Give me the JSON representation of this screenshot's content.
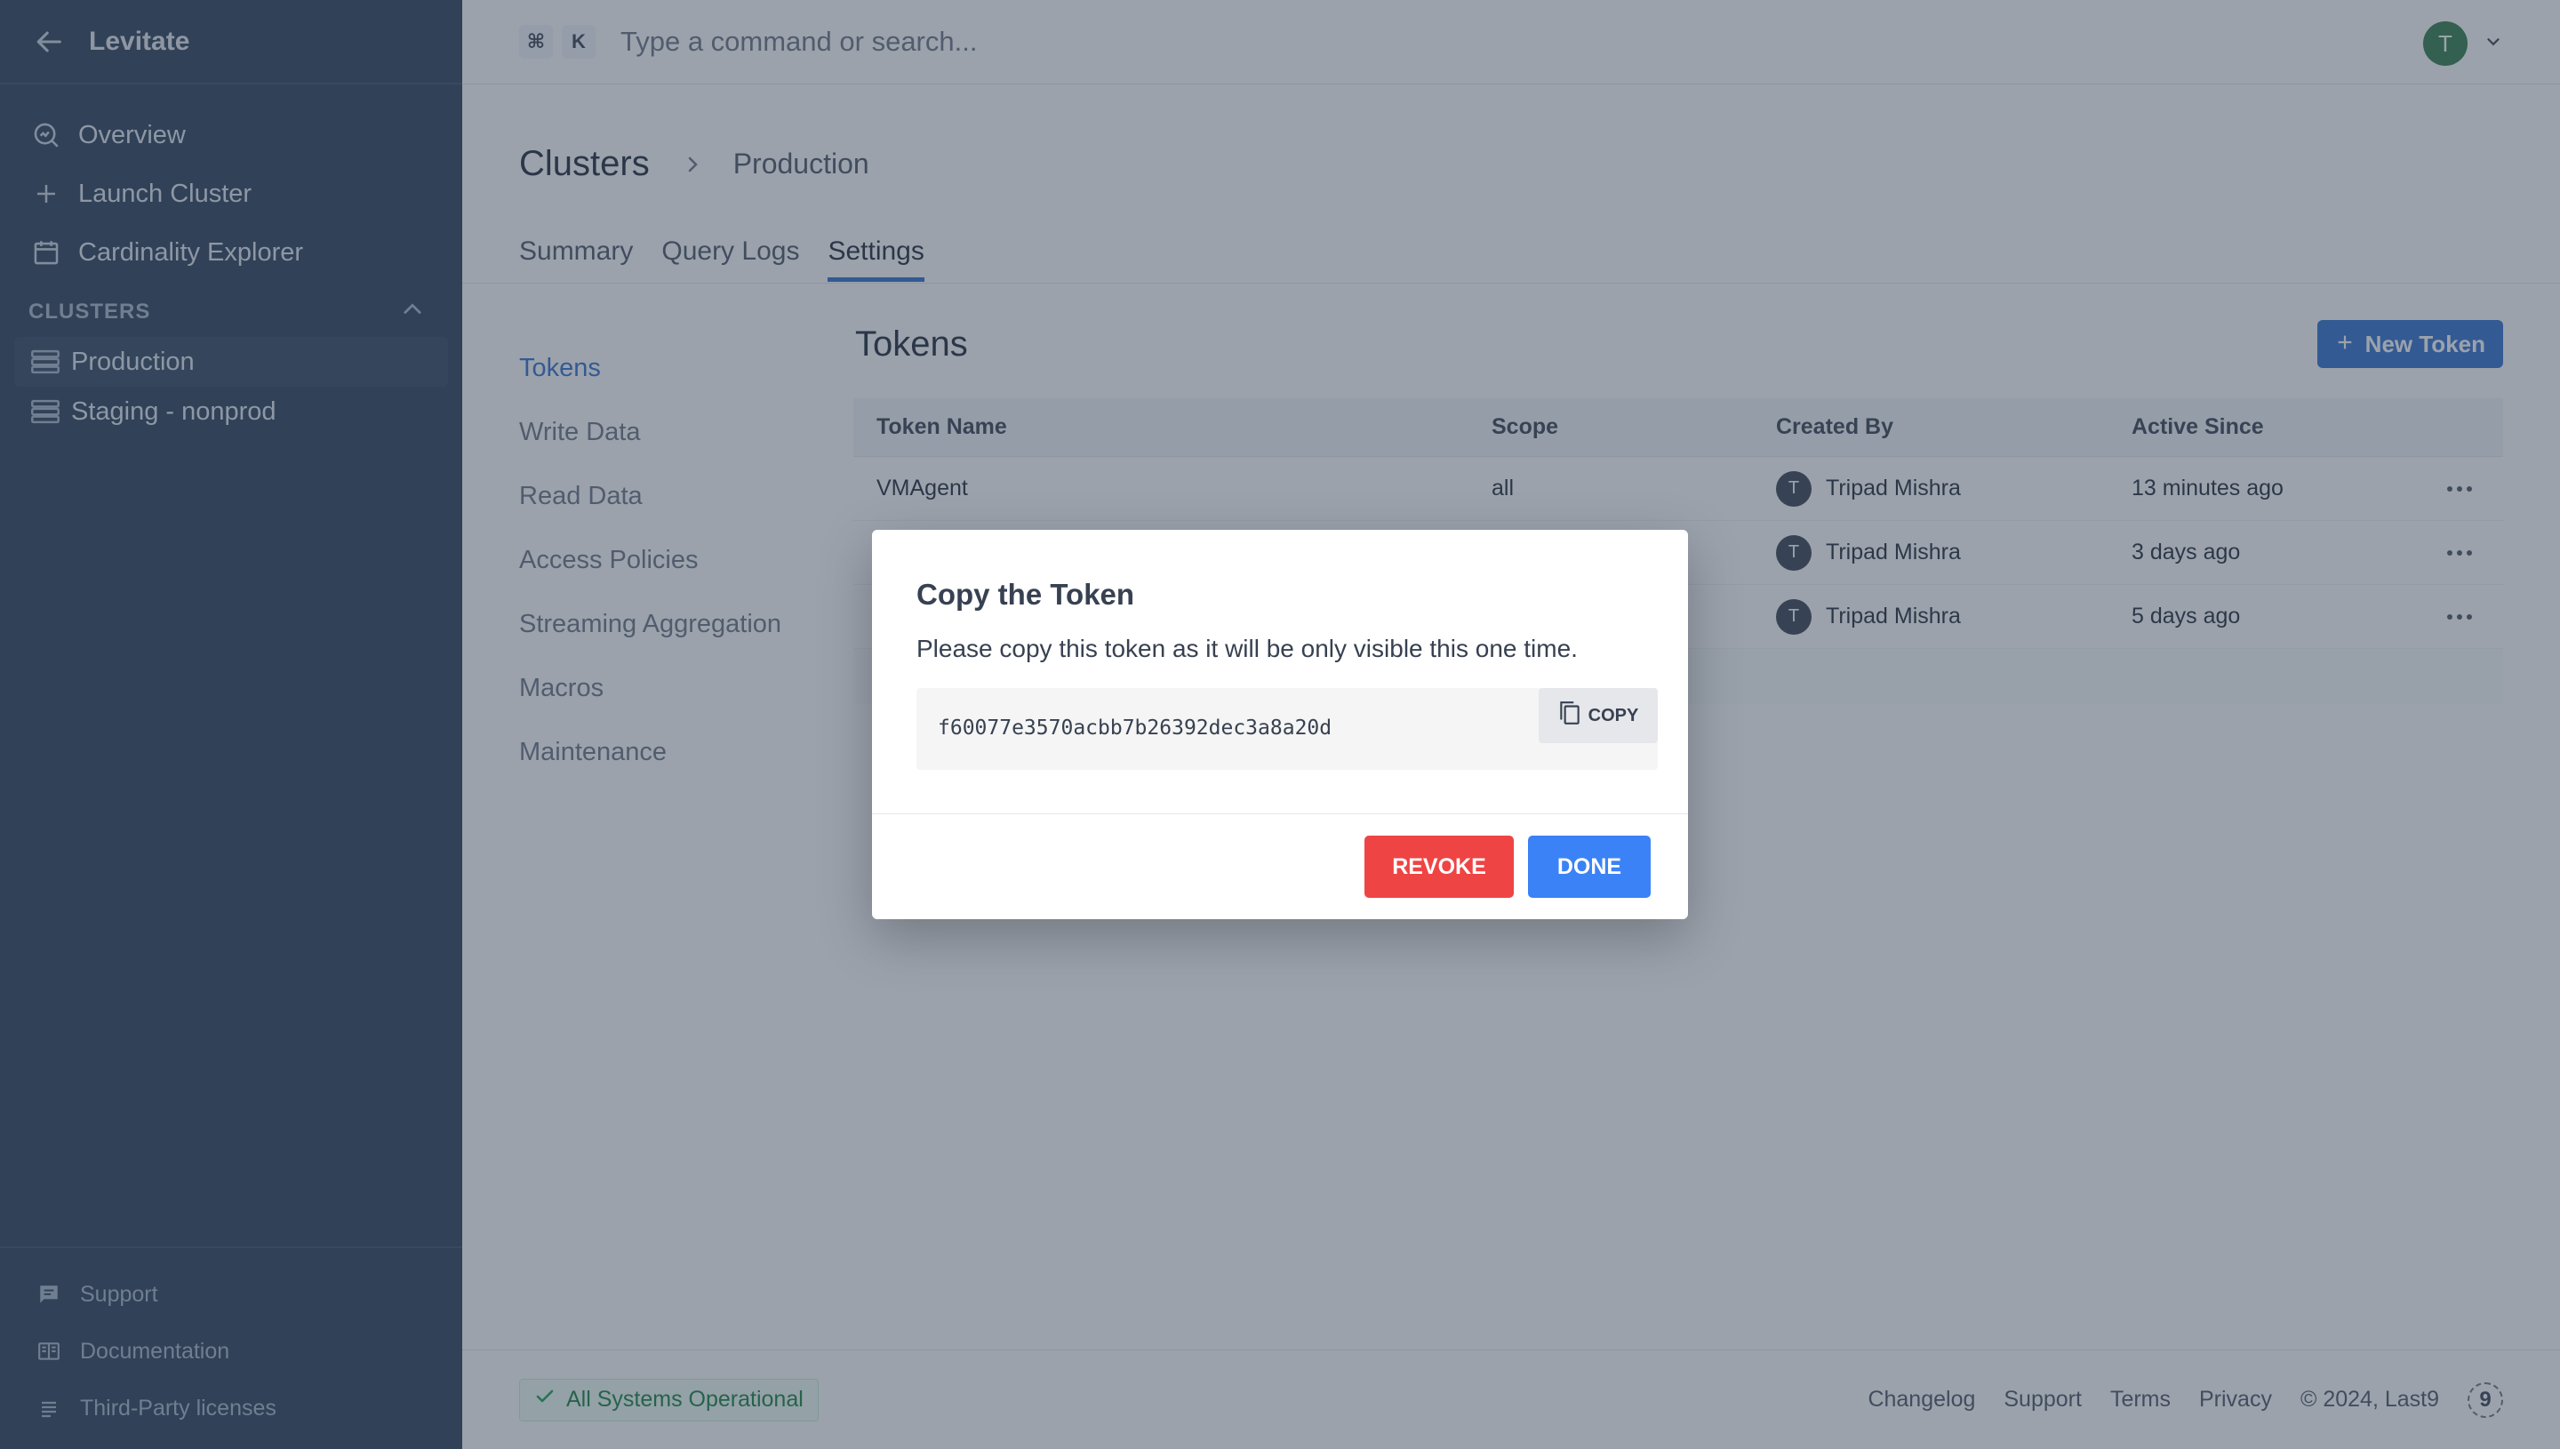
{
  "app": {
    "name": "Levitate"
  },
  "sidebar": {
    "nav": [
      {
        "label": "Overview",
        "icon": "overview-icon"
      },
      {
        "label": "Launch Cluster",
        "icon": "plus-icon"
      },
      {
        "label": "Cardinality Explorer",
        "icon": "calendar-icon"
      }
    ],
    "section_label": "CLUSTERS",
    "clusters": [
      {
        "label": "Production",
        "active": true
      },
      {
        "label": "Staging - nonprod",
        "active": false
      }
    ],
    "footer": [
      {
        "label": "Support",
        "icon": "chat-icon"
      },
      {
        "label": "Documentation",
        "icon": "book-icon"
      },
      {
        "label": "Third-Party licenses",
        "icon": "list-icon"
      }
    ]
  },
  "topbar": {
    "shortcut": [
      "⌘",
      "K"
    ],
    "placeholder": "Type a command or search...",
    "user_initial": "T"
  },
  "page": {
    "title": "Clusters",
    "breadcrumb": "Production",
    "tabs": [
      "Summary",
      "Query Logs",
      "Settings"
    ],
    "active_tab": "Settings"
  },
  "settings_nav": [
    "Tokens",
    "Write Data",
    "Read Data",
    "Access Policies",
    "Streaming Aggregation",
    "Macros",
    "Maintenance"
  ],
  "tokens": {
    "title": "Tokens",
    "new_button": "New Token",
    "columns": [
      "Token Name",
      "Scope",
      "Created By",
      "Active Since"
    ],
    "rows": [
      {
        "name": "VMAgent",
        "scope": "all",
        "creator_initial": "T",
        "creator": "Tripad Mishra",
        "since": "13 minutes ago"
      },
      {
        "name": "",
        "scope": "",
        "creator_initial": "T",
        "creator": "Tripad Mishra",
        "since": "3 days ago"
      },
      {
        "name": "",
        "scope": "",
        "creator_initial": "T",
        "creator": "Tripad Mishra",
        "since": "5 days ago"
      }
    ]
  },
  "footer": {
    "status": "All Systems Operational",
    "links": [
      "Changelog",
      "Support",
      "Terms",
      "Privacy"
    ],
    "copyright": "© 2024, Last9",
    "logo_text": "9"
  },
  "modal": {
    "title": "Copy the Token",
    "message": "Please copy this token as it will be only visible this one time.",
    "token": "f60077e3570acbb7b26392dec3a8a20d",
    "copy_label": "COPY",
    "revoke_label": "REVOKE",
    "done_label": "DONE"
  },
  "colors": {
    "sidebar_bg": "#2b3d55",
    "accent": "#2f6fcc",
    "danger": "#ef4444",
    "primary": "#3b82f6",
    "success": "#15803d"
  }
}
